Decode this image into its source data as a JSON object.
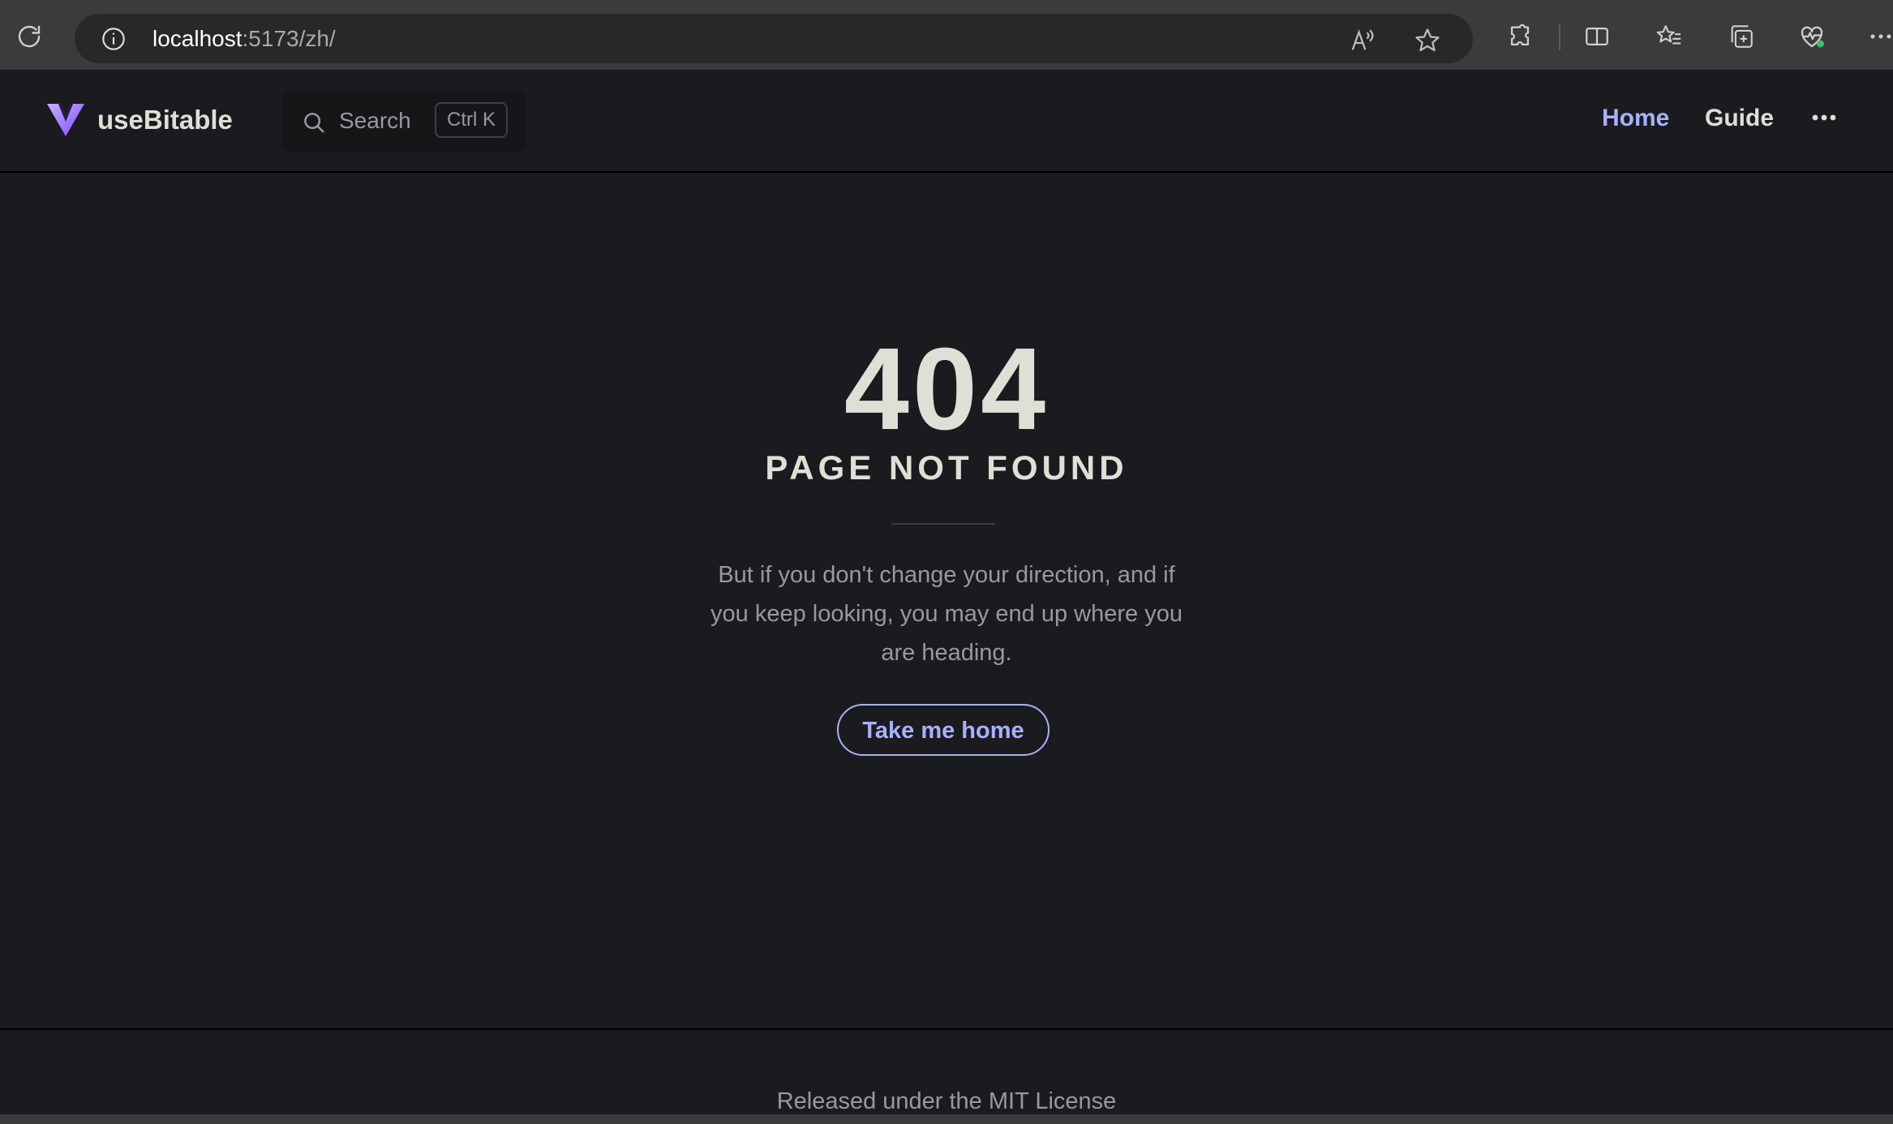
{
  "browser": {
    "url_host": "localhost",
    "url_rest": ":5173/zh/",
    "icons": [
      "reload-icon",
      "info-icon",
      "read-aloud-icon",
      "favorite-star-icon",
      "extensions-icon",
      "split-screen-icon",
      "favorites-icon",
      "collections-icon",
      "browser-essentials-icon",
      "more-icon"
    ]
  },
  "nav": {
    "brand": "useBitable",
    "search_label": "Search",
    "search_shortcut": "Ctrl K",
    "links": [
      {
        "label": "Home",
        "active": true
      },
      {
        "label": "Guide",
        "active": false
      }
    ],
    "accent_color": "#a8b1ff"
  },
  "main": {
    "code": "404",
    "title": "PAGE NOT FOUND",
    "quote": "But if you don't change your direction, and if you keep looking, you may end up where you are heading.",
    "home_button": "Take me home"
  },
  "footer": {
    "message": "Released under the MIT License"
  }
}
